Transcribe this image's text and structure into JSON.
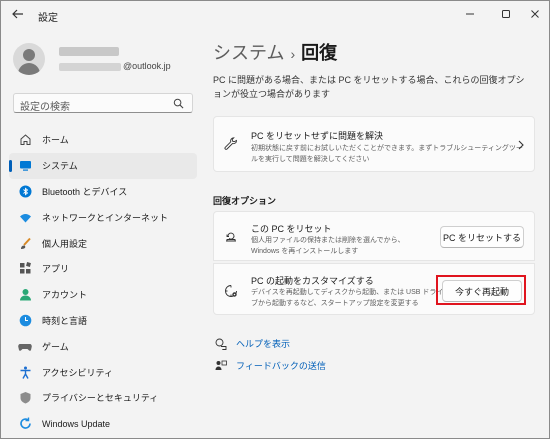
{
  "window": {
    "title": "設定"
  },
  "profile": {
    "email_suffix": "@outlook.jp"
  },
  "search": {
    "placeholder": "設定の検索"
  },
  "nav": {
    "items": [
      {
        "label": "ホーム",
        "icon": "home-icon"
      },
      {
        "label": "システム",
        "icon": "system-icon",
        "active": true
      },
      {
        "label": "Bluetooth とデバイス",
        "icon": "bluetooth-icon"
      },
      {
        "label": "ネットワークとインターネット",
        "icon": "wifi-icon"
      },
      {
        "label": "個人用設定",
        "icon": "brush-icon"
      },
      {
        "label": "アプリ",
        "icon": "apps-icon"
      },
      {
        "label": "アカウント",
        "icon": "account-icon"
      },
      {
        "label": "時刻と言語",
        "icon": "globe-clock-icon"
      },
      {
        "label": "ゲーム",
        "icon": "gamepad-icon"
      },
      {
        "label": "アクセシビリティ",
        "icon": "accessibility-icon"
      },
      {
        "label": "プライバシーとセキュリティ",
        "icon": "shield-icon"
      },
      {
        "label": "Windows Update",
        "icon": "windows-update-icon"
      }
    ]
  },
  "main": {
    "breadcrumb_parent": "システム",
    "breadcrumb_sep": "›",
    "breadcrumb_current": "回復",
    "description": "PC に問題がある場合、または PC をリセットする場合、これらの回復オプションが役立つ場合があります",
    "troubleshoot": {
      "title": "PC をリセットせずに問題を解決",
      "desc": "初期状態に戻す前にお試しいただくことができます。まずトラブルシューティングツールを実行して問題を解決してください"
    },
    "section_title": "回復オプション",
    "reset": {
      "title": "この PC をリセット",
      "desc_line1": "個人用ファイルの保持または削除を選んでから、",
      "desc_line2": "Windows を再インストールします",
      "button": "PC をリセットする"
    },
    "advanced": {
      "title": "PC の起動をカスタマイズする",
      "desc_line1": "デバイスを再起動してディスクから起動、または USB ドライ",
      "desc_line2": "ブから起動するなど、スタートアップ設定を変更する",
      "button": "今すぐ再起動"
    },
    "links": {
      "help": "ヘルプを表示",
      "feedback": "フィードバックの送信"
    }
  },
  "colors": {
    "accent": "#005fb8",
    "highlight": "#e0141e"
  }
}
